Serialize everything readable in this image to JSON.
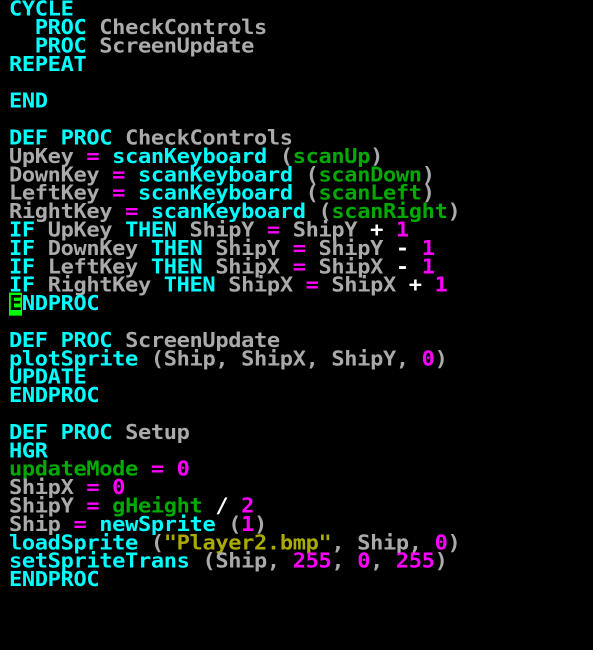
{
  "colors": {
    "background": "#000000",
    "keyword": "#00ffff",
    "identifier": "#aaaaaa",
    "operator_number": "#ff00ff",
    "system_variable": "#00aa00",
    "string": "#aaaa00",
    "cursor": "#00ff00"
  },
  "editor": {
    "lines": [
      [
        {
          "t": "CYCLE",
          "c": "kw"
        }
      ],
      [
        {
          "t": "  PROC ",
          "c": "kw"
        },
        {
          "t": "CheckControls",
          "c": "id"
        }
      ],
      [
        {
          "t": "  PROC ",
          "c": "kw"
        },
        {
          "t": "ScreenUpdate",
          "c": "id"
        }
      ],
      [
        {
          "t": "REPEAT",
          "c": "kw"
        }
      ],
      [],
      [
        {
          "t": "END",
          "c": "kw"
        }
      ],
      [],
      [
        {
          "t": "DEF PROC ",
          "c": "kw"
        },
        {
          "t": "CheckControls",
          "c": "id"
        }
      ],
      [
        {
          "t": "UpKey",
          "c": "id"
        },
        {
          "t": " = ",
          "c": "op"
        },
        {
          "t": "scanKeyboard ",
          "c": "fn"
        },
        {
          "t": "(",
          "c": "pun"
        },
        {
          "t": "scanUp",
          "c": "var"
        },
        {
          "t": ")",
          "c": "pun"
        }
      ],
      [
        {
          "t": "DownKey",
          "c": "id"
        },
        {
          "t": " = ",
          "c": "op"
        },
        {
          "t": "scanKeyboard ",
          "c": "fn"
        },
        {
          "t": "(",
          "c": "pun"
        },
        {
          "t": "scanDown",
          "c": "var"
        },
        {
          "t": ")",
          "c": "pun"
        }
      ],
      [
        {
          "t": "LeftKey",
          "c": "id"
        },
        {
          "t": " = ",
          "c": "op"
        },
        {
          "t": "scanKeyboard ",
          "c": "fn"
        },
        {
          "t": "(",
          "c": "pun"
        },
        {
          "t": "scanLeft",
          "c": "var"
        },
        {
          "t": ")",
          "c": "pun"
        }
      ],
      [
        {
          "t": "RightKey",
          "c": "id"
        },
        {
          "t": " = ",
          "c": "op"
        },
        {
          "t": "scanKeyboard ",
          "c": "fn"
        },
        {
          "t": "(",
          "c": "pun"
        },
        {
          "t": "scanRight",
          "c": "var"
        },
        {
          "t": ")",
          "c": "pun"
        }
      ],
      [
        {
          "t": "IF ",
          "c": "kw"
        },
        {
          "t": "UpKey ",
          "c": "id"
        },
        {
          "t": "THEN ",
          "c": "kw"
        },
        {
          "t": "ShipY",
          "c": "id"
        },
        {
          "t": " = ",
          "c": "op"
        },
        {
          "t": "ShipY ",
          "c": "id"
        },
        {
          "t": "+ ",
          "c": "plain"
        },
        {
          "t": "1",
          "c": "num"
        }
      ],
      [
        {
          "t": "IF ",
          "c": "kw"
        },
        {
          "t": "DownKey ",
          "c": "id"
        },
        {
          "t": "THEN ",
          "c": "kw"
        },
        {
          "t": "ShipY",
          "c": "id"
        },
        {
          "t": " = ",
          "c": "op"
        },
        {
          "t": "ShipY ",
          "c": "id"
        },
        {
          "t": "- ",
          "c": "plain"
        },
        {
          "t": "1",
          "c": "num"
        }
      ],
      [
        {
          "t": "IF ",
          "c": "kw"
        },
        {
          "t": "LeftKey ",
          "c": "id"
        },
        {
          "t": "THEN ",
          "c": "kw"
        },
        {
          "t": "ShipX",
          "c": "id"
        },
        {
          "t": " = ",
          "c": "op"
        },
        {
          "t": "ShipX ",
          "c": "id"
        },
        {
          "t": "- ",
          "c": "plain"
        },
        {
          "t": "1",
          "c": "num"
        }
      ],
      [
        {
          "t": "IF ",
          "c": "kw"
        },
        {
          "t": "RightKey ",
          "c": "id"
        },
        {
          "t": "THEN ",
          "c": "kw"
        },
        {
          "t": "ShipX",
          "c": "id"
        },
        {
          "t": " = ",
          "c": "op"
        },
        {
          "t": "ShipX ",
          "c": "id"
        },
        {
          "t": "+ ",
          "c": "plain"
        },
        {
          "t": "1",
          "c": "num"
        }
      ],
      [
        {
          "t": "E",
          "c": "kw",
          "cursor": true
        },
        {
          "t": "NDPROC",
          "c": "kw"
        }
      ],
      [],
      [
        {
          "t": "DEF PROC ",
          "c": "kw"
        },
        {
          "t": "ScreenUpdate",
          "c": "id"
        }
      ],
      [
        {
          "t": "plotSprite ",
          "c": "fn"
        },
        {
          "t": "(Ship, ShipX, ShipY, ",
          "c": "pun"
        },
        {
          "t": "0",
          "c": "num"
        },
        {
          "t": ")",
          "c": "pun"
        }
      ],
      [
        {
          "t": "UPDATE",
          "c": "kw"
        }
      ],
      [
        {
          "t": "ENDPROC",
          "c": "kw"
        }
      ],
      [],
      [
        {
          "t": "DEF PROC ",
          "c": "kw"
        },
        {
          "t": "Setup",
          "c": "id"
        }
      ],
      [
        {
          "t": "HGR",
          "c": "kw"
        }
      ],
      [
        {
          "t": "updateMode",
          "c": "var"
        },
        {
          "t": " = ",
          "c": "op"
        },
        {
          "t": "0",
          "c": "num"
        }
      ],
      [
        {
          "t": "ShipX",
          "c": "id"
        },
        {
          "t": " = ",
          "c": "op"
        },
        {
          "t": "0",
          "c": "num"
        }
      ],
      [
        {
          "t": "ShipY",
          "c": "id"
        },
        {
          "t": " = ",
          "c": "op"
        },
        {
          "t": "gHeight",
          "c": "var"
        },
        {
          "t": " / ",
          "c": "plain"
        },
        {
          "t": "2",
          "c": "num"
        }
      ],
      [
        {
          "t": "Ship",
          "c": "id"
        },
        {
          "t": " = ",
          "c": "op"
        },
        {
          "t": "newSprite ",
          "c": "fn"
        },
        {
          "t": "(",
          "c": "pun"
        },
        {
          "t": "1",
          "c": "num"
        },
        {
          "t": ")",
          "c": "pun"
        }
      ],
      [
        {
          "t": "loadSprite ",
          "c": "fn"
        },
        {
          "t": "(",
          "c": "pun"
        },
        {
          "t": "\"Player2.bmp\"",
          "c": "str"
        },
        {
          "t": ", Ship, ",
          "c": "pun"
        },
        {
          "t": "0",
          "c": "num"
        },
        {
          "t": ")",
          "c": "pun"
        }
      ],
      [
        {
          "t": "setSpriteTrans ",
          "c": "fn"
        },
        {
          "t": "(Ship, ",
          "c": "pun"
        },
        {
          "t": "255",
          "c": "num"
        },
        {
          "t": ", ",
          "c": "pun"
        },
        {
          "t": "0",
          "c": "num"
        },
        {
          "t": ", ",
          "c": "pun"
        },
        {
          "t": "255",
          "c": "num"
        },
        {
          "t": ")",
          "c": "pun"
        }
      ],
      [
        {
          "t": "ENDPROC",
          "c": "kw"
        }
      ]
    ]
  }
}
